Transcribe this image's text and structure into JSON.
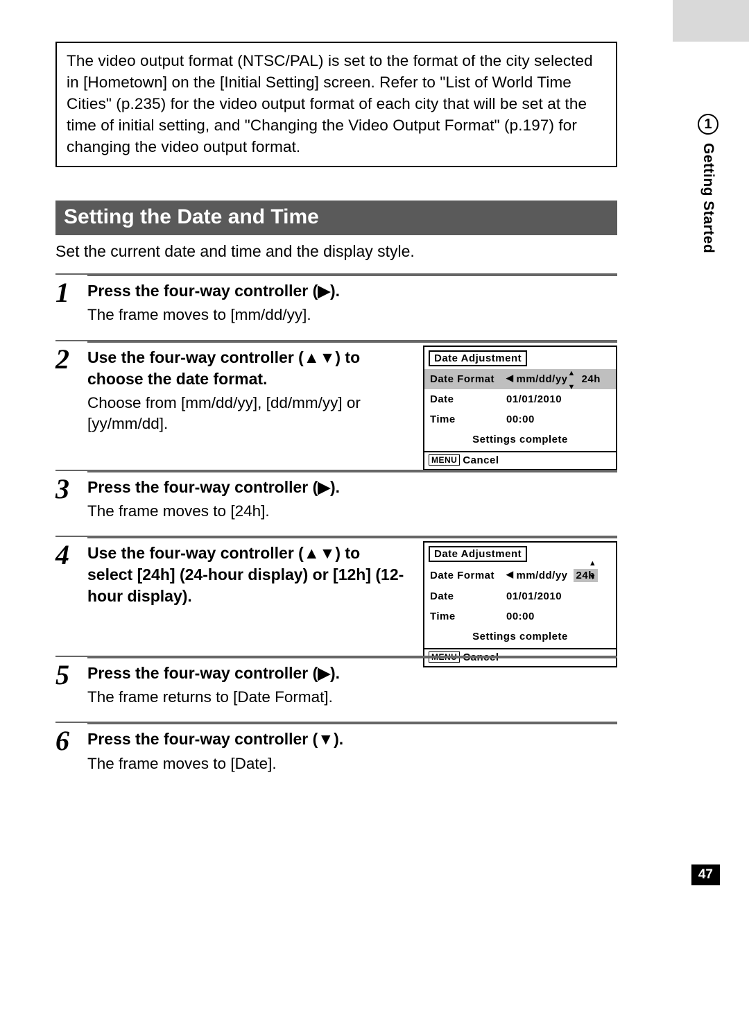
{
  "note_box": "The video output format (NTSC/PAL) is set to the format of the city selected in [Hometown] on the [Initial Setting] screen. Refer to \"List of World Time Cities\" (p.235) for the video output format of each city that will be set at the time of initial setting, and \"Changing the Video Output Format\" (p.197) for changing the video output format.",
  "section": {
    "title": "Setting the Date and Time",
    "subtitle": "Set the current date and time and the display style."
  },
  "steps": [
    {
      "num": "1",
      "title_pre": "Press the four-way controller (",
      "title_icon": "▶",
      "title_post": ").",
      "desc": "The frame moves to [mm/dd/yy]."
    },
    {
      "num": "2",
      "title_pre": "Use the four-way controller (",
      "title_icon": "▲▼",
      "title_post": ") to choose the date format.",
      "desc": "Choose from [mm/dd/yy], [dd/mm/yy] or [yy/mm/dd]."
    },
    {
      "num": "3",
      "title_pre": "Press the four-way controller (",
      "title_icon": "▶",
      "title_post": ").",
      "desc": "The frame moves to [24h]."
    },
    {
      "num": "4",
      "title_pre": "Use the four-way controller (",
      "title_icon": "▲▼",
      "title_post": ") to select [24h] (24-hour display) or [12h] (12-hour display).",
      "desc": ""
    },
    {
      "num": "5",
      "title_pre": "Press the four-way controller (",
      "title_icon": "▶",
      "title_post": ").",
      "desc": "The frame returns to [Date Format]."
    },
    {
      "num": "6",
      "title_pre": "Press the four-way controller (",
      "title_icon": "▼",
      "title_post": ").",
      "desc": "The frame moves to [Date]."
    }
  ],
  "screen1": {
    "title": "Date Adjustment",
    "rows": {
      "format_label": "Date Format",
      "format_val": "mm/dd/yy",
      "format_suffix": "24h",
      "date_label": "Date",
      "date_val": "01/01/2010",
      "time_label": "Time",
      "time_val": "00:00"
    },
    "settings_complete": "Settings complete",
    "footer_menu": "MENU",
    "footer_cancel": "Cancel"
  },
  "screen2": {
    "title": "Date Adjustment",
    "rows": {
      "format_label": "Date Format",
      "format_val": "mm/dd/yy",
      "format_suffix": "24h",
      "date_label": "Date",
      "date_val": "01/01/2010",
      "time_label": "Time",
      "time_val": "00:00"
    },
    "settings_complete": "Settings complete",
    "footer_menu": "MENU",
    "footer_cancel": "Cancel"
  },
  "chapter": {
    "num": "1",
    "label": "Getting Started"
  },
  "page_number": "47"
}
